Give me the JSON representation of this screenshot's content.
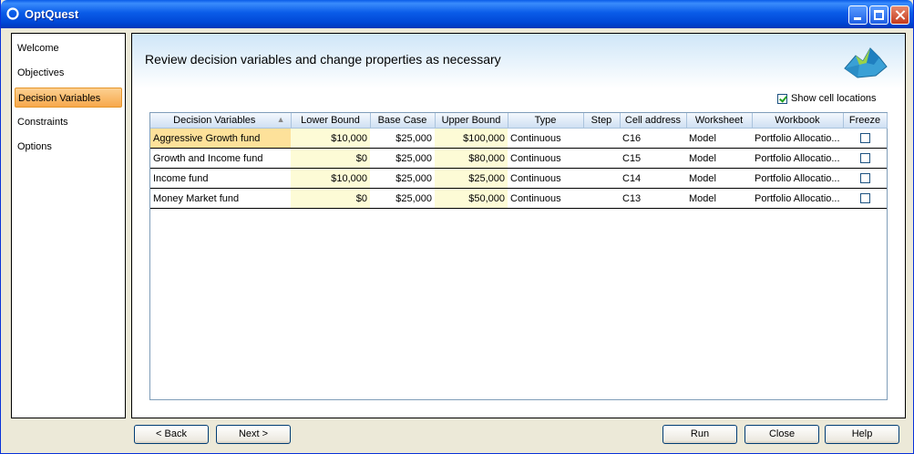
{
  "window": {
    "title": "OptQuest"
  },
  "sidebar": {
    "items": [
      {
        "label": "Welcome",
        "active": false
      },
      {
        "label": "Objectives",
        "active": false
      },
      {
        "label": "Decision Variables",
        "active": true
      },
      {
        "label": "Constraints",
        "active": false
      },
      {
        "label": "Options",
        "active": false
      }
    ]
  },
  "main": {
    "title": "Review decision variables and change properties as necessary",
    "show_cells_label": "Show cell locations",
    "show_cells_checked": true
  },
  "table": {
    "headers": [
      "Decision Variables",
      "Lower Bound",
      "Base Case",
      "Upper Bound",
      "Type",
      "Step",
      "Cell address",
      "Worksheet",
      "Workbook",
      "Freeze"
    ],
    "rows": [
      {
        "name": "Aggressive Growth fund",
        "lower": "$10,000",
        "base": "$25,000",
        "upper": "$100,000",
        "type": "Continuous",
        "step": "",
        "cell": "C16",
        "worksheet": "Model",
        "workbook": "Portfolio Allocatio...",
        "freeze": false
      },
      {
        "name": "Growth and Income fund",
        "lower": "$0",
        "base": "$25,000",
        "upper": "$80,000",
        "type": "Continuous",
        "step": "",
        "cell": "C15",
        "worksheet": "Model",
        "workbook": "Portfolio Allocatio...",
        "freeze": false
      },
      {
        "name": "Income fund",
        "lower": "$10,000",
        "base": "$25,000",
        "upper": "$25,000",
        "type": "Continuous",
        "step": "",
        "cell": "C14",
        "worksheet": "Model",
        "workbook": "Portfolio Allocatio...",
        "freeze": false
      },
      {
        "name": "Money Market fund",
        "lower": "$0",
        "base": "$25,000",
        "upper": "$50,000",
        "type": "Continuous",
        "step": "",
        "cell": "C13",
        "worksheet": "Model",
        "workbook": "Portfolio Allocatio...",
        "freeze": false
      }
    ]
  },
  "buttons": {
    "back": "< Back",
    "next": "Next >",
    "run": "Run",
    "close": "Close",
    "help": "Help"
  },
  "colors": {
    "titlebar": "#0a5ce8",
    "active_nav": "#f7a84b",
    "selected_cell": "#fde19a",
    "bound_cells": "#fdfbd6"
  },
  "icons": {
    "app": "optquest-app-icon",
    "logo": "optquest-3d-surface-logo"
  }
}
